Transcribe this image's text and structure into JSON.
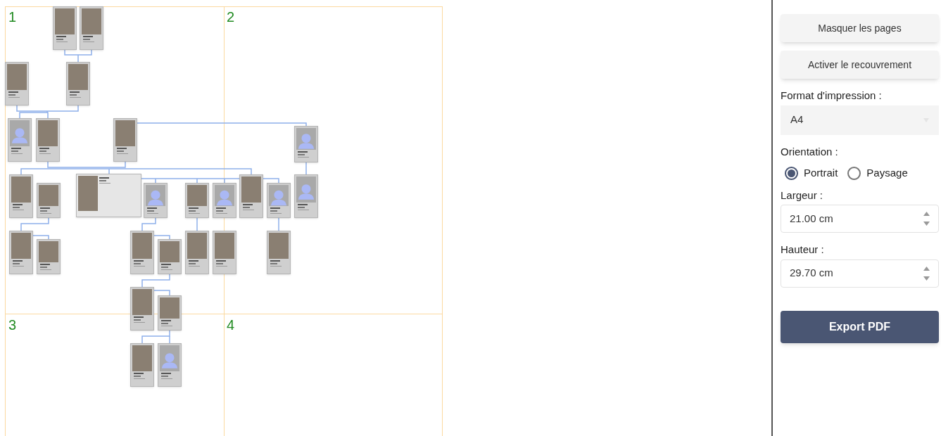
{
  "pages": [
    {
      "label": "1"
    },
    {
      "label": "2"
    },
    {
      "label": "3"
    },
    {
      "label": "4"
    }
  ],
  "cards": [
    {
      "kind": "photo"
    },
    {
      "kind": "photo"
    },
    {
      "kind": "photo"
    },
    {
      "kind": "photo"
    },
    {
      "kind": "silhouette"
    },
    {
      "kind": "photo"
    },
    {
      "kind": "photo"
    },
    {
      "kind": "silhouette"
    },
    {
      "kind": "photo"
    },
    {
      "kind": "photo"
    },
    {
      "kind": "wide"
    },
    {
      "kind": "silhouette"
    },
    {
      "kind": "photo"
    },
    {
      "kind": "silhouette"
    },
    {
      "kind": "photo"
    },
    {
      "kind": "silhouette"
    },
    {
      "kind": "silhouette"
    },
    {
      "kind": "photo"
    },
    {
      "kind": "photo"
    },
    {
      "kind": "photo"
    },
    {
      "kind": "photo"
    },
    {
      "kind": "photo"
    },
    {
      "kind": "photo"
    },
    {
      "kind": "photo"
    },
    {
      "kind": "photo"
    },
    {
      "kind": "photo"
    },
    {
      "kind": "photo"
    },
    {
      "kind": "silhouette"
    }
  ],
  "panel": {
    "buttons": [
      "Masquer les pages",
      "Activer le recouvrement"
    ],
    "format": {
      "label": "Format d'impression :",
      "value": "A4"
    },
    "orientation": {
      "label": "Orientation :",
      "options": [
        {
          "label": "Portrait",
          "selected": true
        },
        {
          "label": "Paysage",
          "selected": false
        }
      ]
    },
    "width": {
      "label": "Largeur :",
      "value": "21.00 cm"
    },
    "height": {
      "label": "Hauteur :",
      "value": "29.70 cm"
    },
    "export": "Export PDF"
  }
}
